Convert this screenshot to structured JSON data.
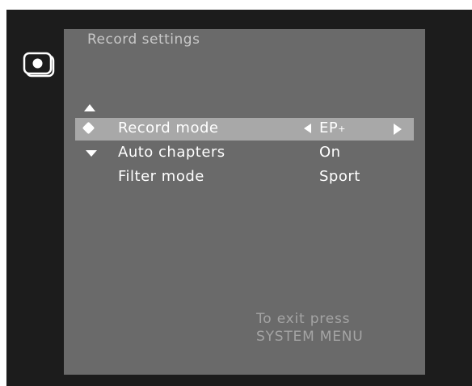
{
  "colors": {
    "screen_background": "#1c1c1c",
    "panel_background": "#6a6a6a",
    "selected_row": "#a8a8a8",
    "text": "#ffffff",
    "hint_text": "#a4a4a4"
  },
  "side_icon": "record-mode-icon",
  "menu": {
    "title": "Record settings",
    "scroll_up_icon": "triangle-up-icon",
    "items": [
      {
        "label": "Record mode",
        "value": "EP",
        "value_suffix": "+",
        "selected": true,
        "marker_icon": "diamond-icon",
        "has_value_arrows": true
      },
      {
        "label": "Auto chapters",
        "value": "On",
        "selected": false,
        "marker_icon": "triangle-down-icon"
      },
      {
        "label": "Filter mode",
        "value": "Sport",
        "selected": false
      }
    ],
    "exit_hint": {
      "line1": "To exit press",
      "line2": "SYSTEM MENU"
    }
  }
}
